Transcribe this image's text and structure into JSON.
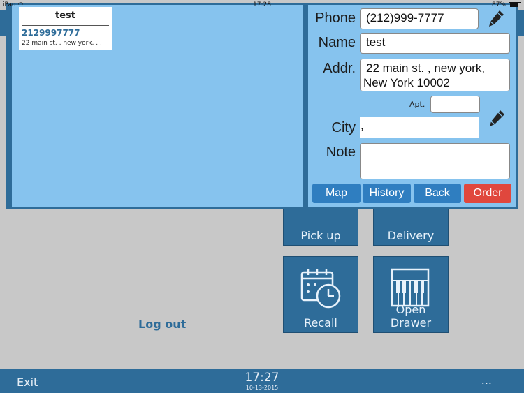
{
  "status_bar": {
    "device": "iPad",
    "time": "17:28",
    "battery": "87%"
  },
  "tiles": [
    {
      "label": "Pick up",
      "icon": "pickup-icon"
    },
    {
      "label": "Delivery",
      "icon": "delivery-icon"
    },
    {
      "label": "Recall",
      "icon": "calendar-clock-icon"
    },
    {
      "label": "Open Drawer",
      "icon": "cash-drawer-icon"
    }
  ],
  "logout_label": "Log out",
  "bottom_bar": {
    "exit_label": "Exit",
    "clock": "17:27",
    "date": "10-13-2015",
    "more_label": "..."
  },
  "customer_card": {
    "name": "test",
    "phone": "2129997777",
    "address": "22 main st. , new york, ..."
  },
  "form": {
    "phone_label": "Phone",
    "phone_value": "(212)999-7777",
    "name_label": "Name",
    "name_value": "test",
    "addr_label": "Addr.",
    "addr_line1": "22 main st. , new york,",
    "addr_line2": "New York 10002",
    "apt_label": "Apt.",
    "apt_value": "",
    "city_label": "City",
    "city_value": ",",
    "note_label": "Note",
    "note_value": ""
  },
  "buttons": {
    "map": "Map",
    "history": "History",
    "back": "Back",
    "order": "Order"
  },
  "colors": {
    "primary": "#2e6c99",
    "pane": "#86c3ee",
    "order": "#e0473d",
    "button": "#2f7ec0"
  }
}
